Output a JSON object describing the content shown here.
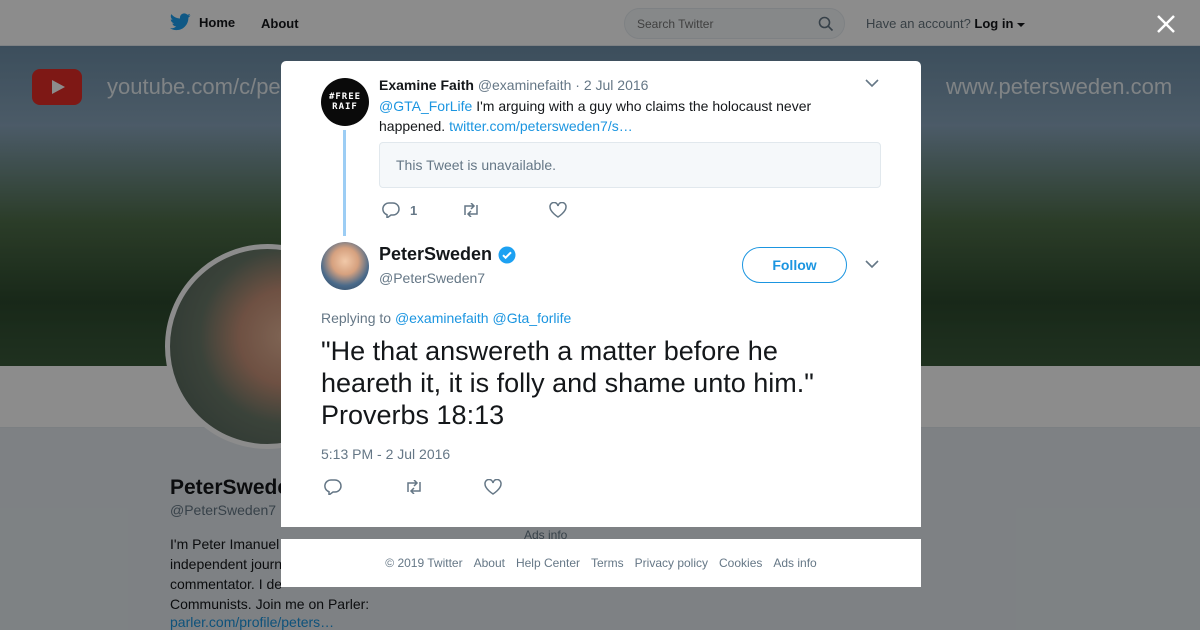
{
  "topbar": {
    "home_label": "Home",
    "about_label": "About",
    "search_placeholder": "Search Twitter",
    "account_prefix": "Have an account?",
    "login_label": "Log in"
  },
  "banner": {
    "youtube_text": "youtube.com/c/peters",
    "site_text": "www.petersweden.com"
  },
  "profile": {
    "name": "PeterSwede",
    "handle": "@PeterSweden7",
    "bio": "I'm Peter Imanuel... Swedish independent journ... commentator. I de... Communists. Join me on Parler:",
    "bio_lines": [
      "I'm Peter Imanuel",
      "independent journ",
      "commentator. I de",
      "Communists. Join me on Parler:"
    ],
    "link": "parler.com/profile/peters…",
    "ads_info": "Ads info"
  },
  "parent_tweet": {
    "avatar_text": "#FREE RAIF",
    "name": "Examine Faith",
    "handle": "@examinefaith",
    "date": "· 2 Jul 2016",
    "mention": "@GTA_ForLife",
    "text": " I'm arguing with a guy who claims the holocaust never happened. ",
    "link": "twitter.com/petersweden7/s…",
    "unavailable_text": "This Tweet is unavailable.",
    "reply_count": "1"
  },
  "main_tweet": {
    "name": "PeterSweden",
    "handle": "@PeterSweden7",
    "follow_label": "Follow",
    "replying_prefix": "Replying to",
    "replying_to": [
      "@examinefaith",
      "@Gta_forlife"
    ],
    "text": "\"He that answereth a matter before he heareth it, it is folly and shame unto him.\" Proverbs 18:13",
    "timestamp": "5:13 PM - 2 Jul 2016"
  },
  "footer": {
    "items": [
      "© 2019 Twitter",
      "About",
      "Help Center",
      "Terms",
      "Privacy policy",
      "Cookies",
      "Ads info"
    ]
  },
  "colors": {
    "twitter_blue": "#1da1f2",
    "link_blue": "#1b95e0",
    "muted": "#657786",
    "thread_line": "#9ccdf4"
  },
  "icons": [
    "twitter-bird-icon",
    "search-icon",
    "caret-down-icon",
    "close-icon",
    "chevron-down-icon",
    "reply-icon",
    "retweet-icon",
    "like-icon",
    "verified-badge-icon",
    "youtube-logo-icon"
  ]
}
